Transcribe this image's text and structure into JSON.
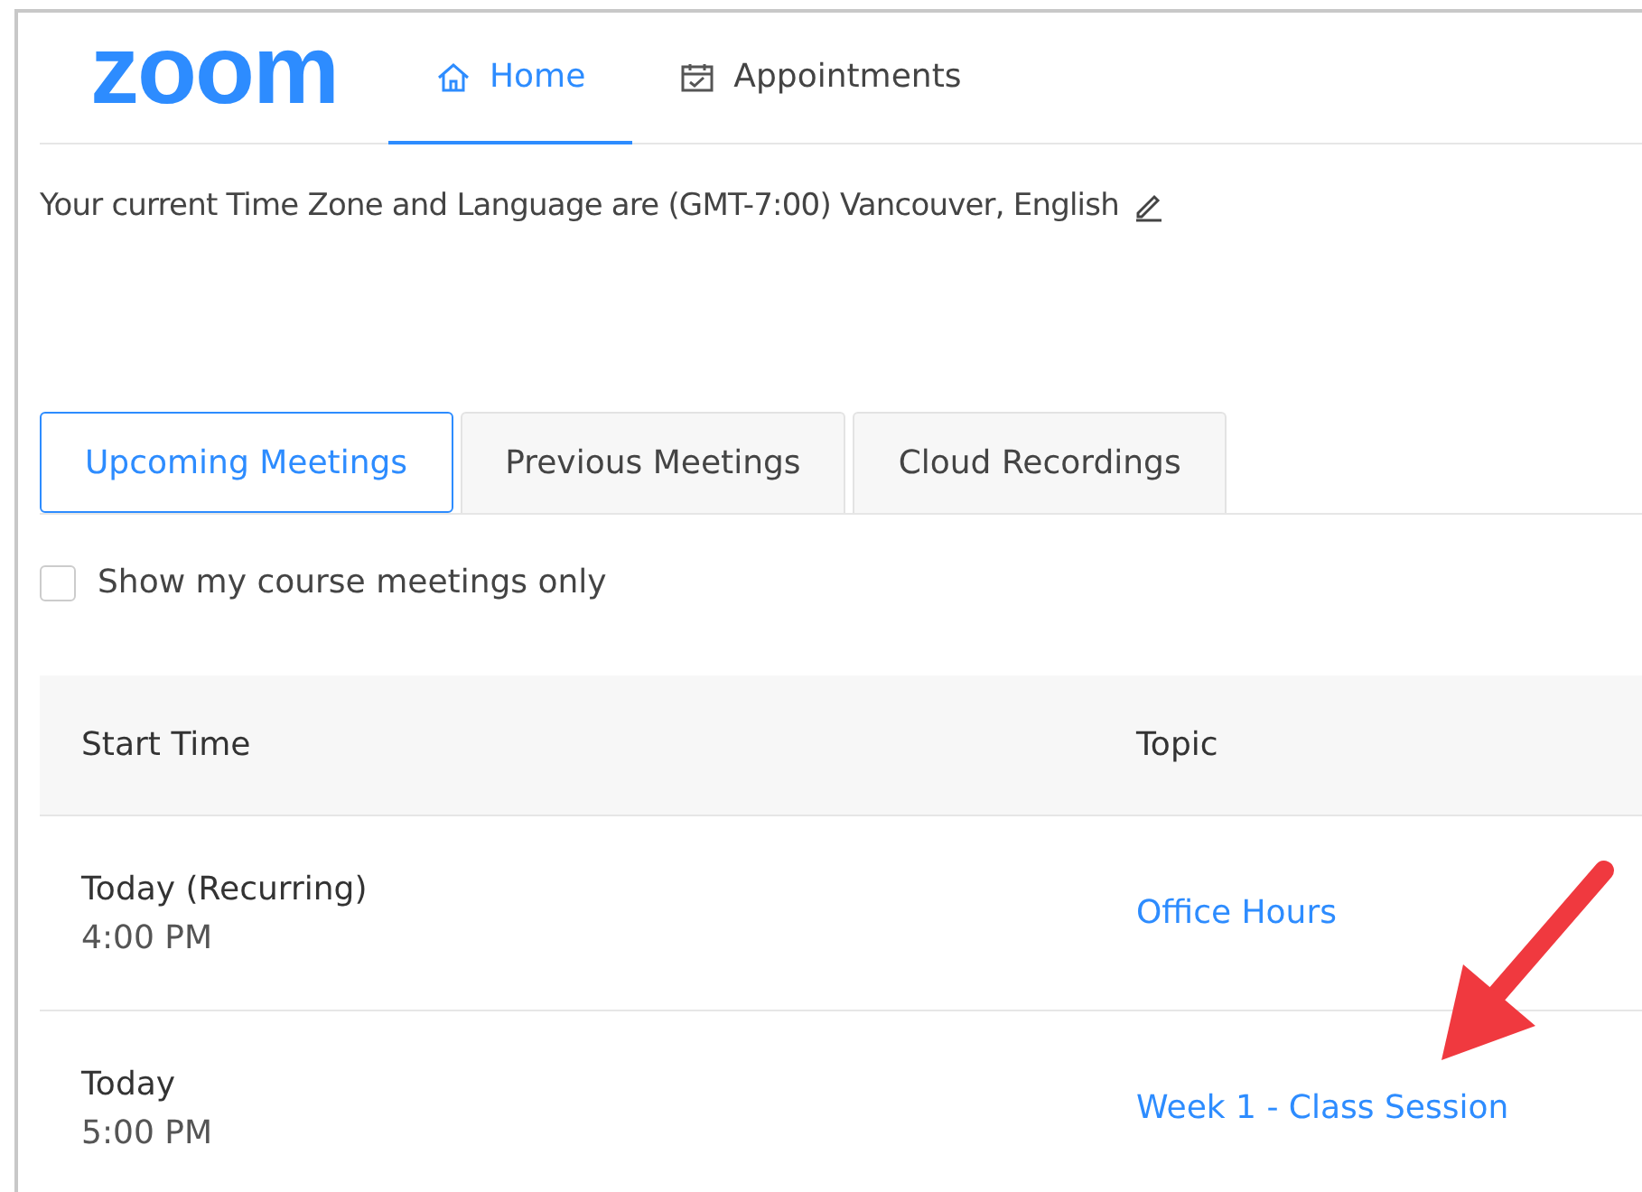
{
  "logo": "zoom",
  "nav": [
    {
      "label": "Home",
      "selected": true
    },
    {
      "label": "Appointments",
      "selected": false
    }
  ],
  "timezone_text": "Your current Time Zone and Language are (GMT-7:00) Vancouver, English",
  "tabs": [
    {
      "label": "Upcoming Meetings",
      "selected": true
    },
    {
      "label": "Previous Meetings",
      "selected": false
    },
    {
      "label": "Cloud Recordings",
      "selected": false
    }
  ],
  "filter": {
    "label": "Show my course meetings only",
    "checked": false
  },
  "table": {
    "columns": [
      "Start Time",
      "Topic"
    ],
    "rows": [
      {
        "day": "Today (Recurring)",
        "time": "4:00 PM",
        "topic": "Office Hours"
      },
      {
        "day": "Today",
        "time": "5:00 PM",
        "topic": "Week 1 - Class Session"
      }
    ]
  }
}
